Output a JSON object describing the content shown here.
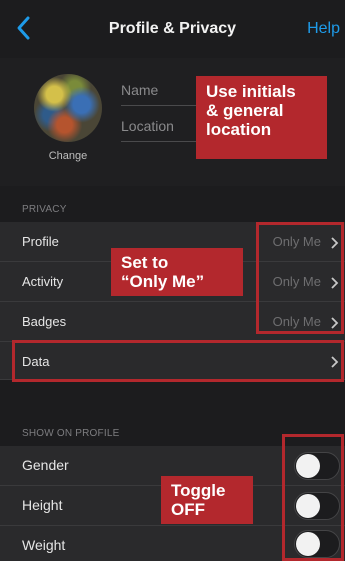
{
  "nav": {
    "title": "Profile & Privacy",
    "help": "Help"
  },
  "profile": {
    "change_label": "Change",
    "name_placeholder": "Name",
    "location_placeholder": "Location"
  },
  "sections": {
    "privacy": "PRIVACY",
    "show_on_profile": "SHOW ON PROFILE"
  },
  "privacy_rows": [
    {
      "label": "Profile",
      "value": "Only Me"
    },
    {
      "label": "Activity",
      "value": "Only Me"
    },
    {
      "label": "Badges",
      "value": "Only Me"
    },
    {
      "label": "Data"
    }
  ],
  "show_rows": [
    {
      "label": "Gender",
      "on": false
    },
    {
      "label": "Height",
      "on": false
    },
    {
      "label": "Weight",
      "on": false
    }
  ],
  "callouts": {
    "initials": "Use initials\n& general\nlocation",
    "only_me": "Set to\n“Only Me”",
    "toggle": "Toggle\nOFF"
  },
  "colors": {
    "accent": "#1e9be9",
    "annotation": "#b3282d",
    "background": "#1c1c1e",
    "row": "#2a2a2c"
  }
}
